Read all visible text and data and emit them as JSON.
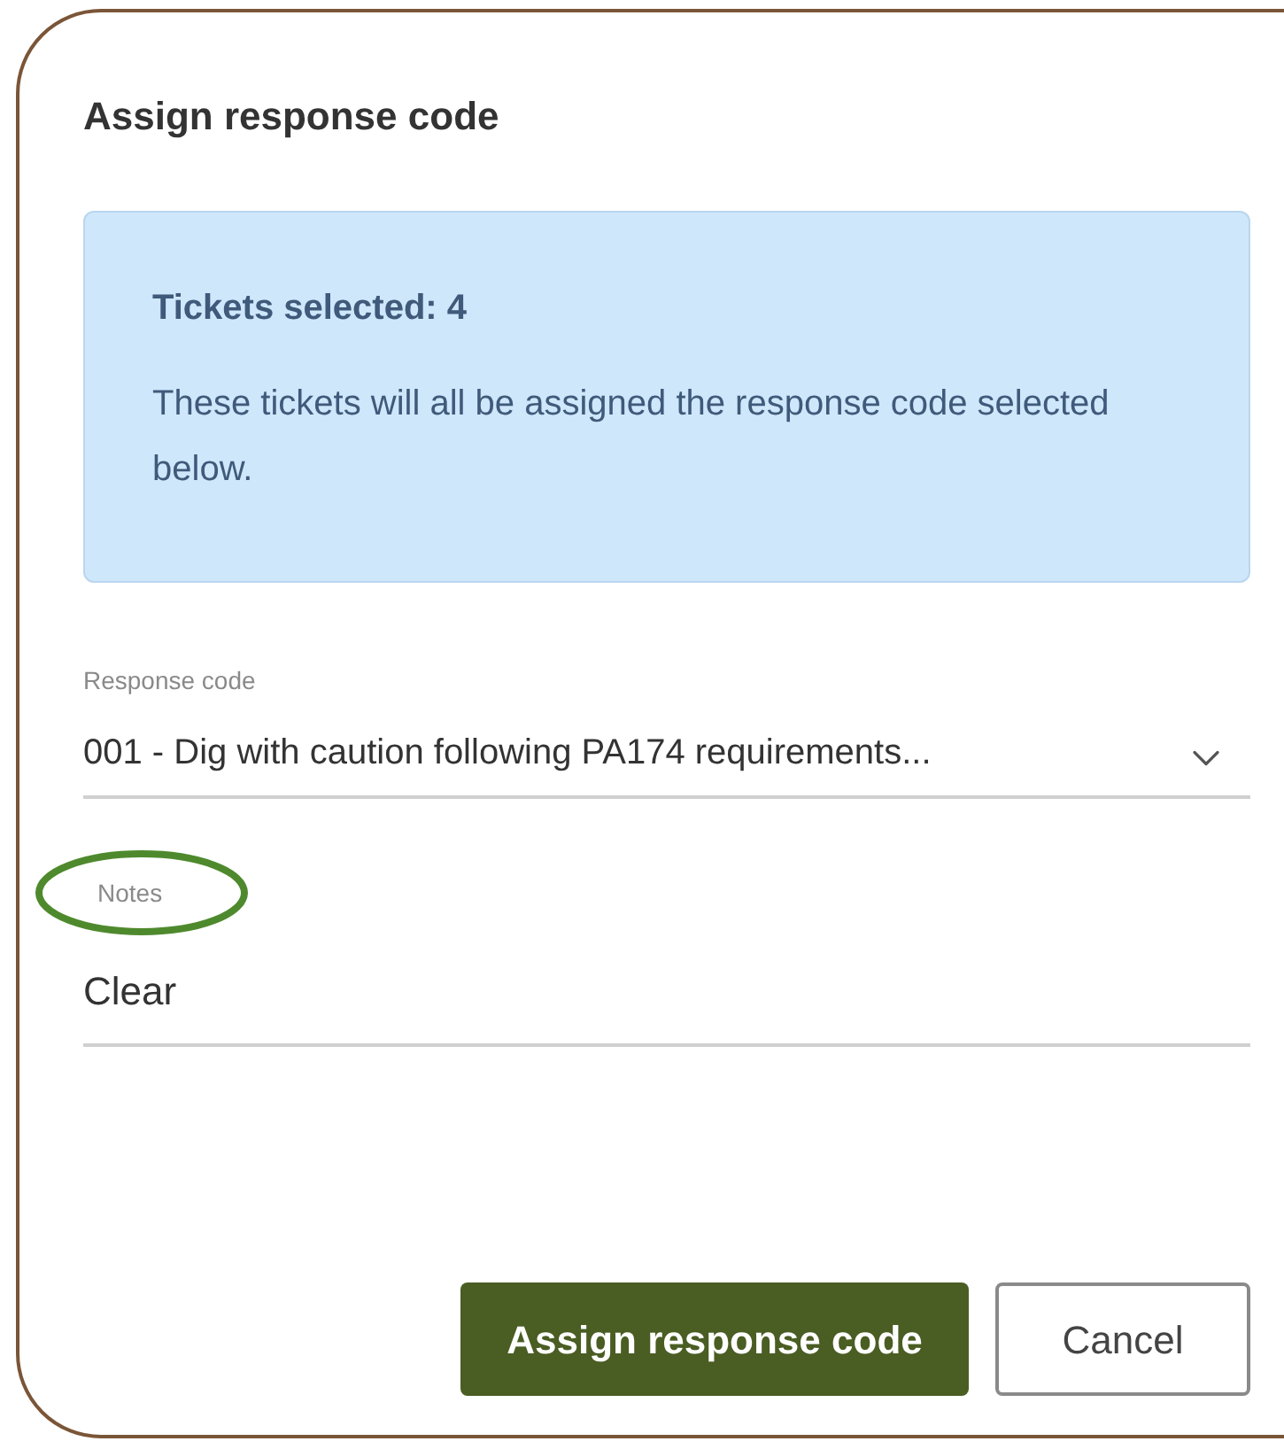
{
  "dialog": {
    "title": "Assign response code"
  },
  "info": {
    "heading": "Tickets selected: 4",
    "message": "These tickets will all be assigned the response code selected below."
  },
  "fields": [
    {
      "kind": "select",
      "label": "Response code",
      "value": "001 - Dig with caution following PA174 requirements...",
      "highlighted": false
    },
    {
      "kind": "text",
      "label": "Notes",
      "value": "Clear",
      "highlighted": true
    }
  ],
  "buttons": [
    {
      "label": "Assign response code",
      "kind": "primary"
    },
    {
      "label": "Cancel",
      "kind": "secondary"
    }
  ]
}
